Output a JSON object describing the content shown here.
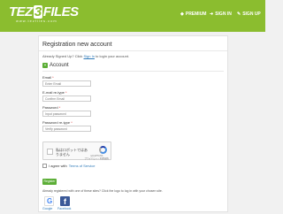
{
  "header": {
    "logo_main": "TEZ",
    "logo_badge": "3",
    "logo_end": "FILES",
    "logo_sub": "www.tezfiles.com",
    "nav": [
      {
        "label": "PREMIUM",
        "icon": "diamond-icon"
      },
      {
        "label": "SIGN IN",
        "icon": "signin-icon"
      },
      {
        "label": "SIGN UP",
        "icon": "signup-icon"
      }
    ]
  },
  "form": {
    "title": "Registration new account",
    "subtitle_pre": "Already Signed Up? Click",
    "subtitle_link": "Sign In",
    "subtitle_post": "to login your account.",
    "section_title": "Account",
    "fields": [
      {
        "label": "Email",
        "placeholder": "Enter Email"
      },
      {
        "label": "E-mail re-type",
        "placeholder": "Confirm Email"
      },
      {
        "label": "Password",
        "placeholder": "Input password"
      },
      {
        "label": "Password re-type",
        "placeholder": "Verify password"
      }
    ],
    "captcha": {
      "text": "私はロボットではありません",
      "brand": "reCAPTCHA",
      "brand_sub": "プライバシー・利用規約"
    },
    "agree_pre": "I agree with",
    "agree_link": "Terms of Service",
    "register_label": "Register",
    "social_text": "Already registered with one of these sites? Click the logo to log in with your chosen site.",
    "social": [
      {
        "label": "Google"
      },
      {
        "label": "Facebook"
      }
    ]
  },
  "colors": {
    "brand_green": "#8bbd2f",
    "button_green": "#5cae37",
    "link_blue": "#2f7ab8",
    "facebook_blue": "#3b5998"
  }
}
